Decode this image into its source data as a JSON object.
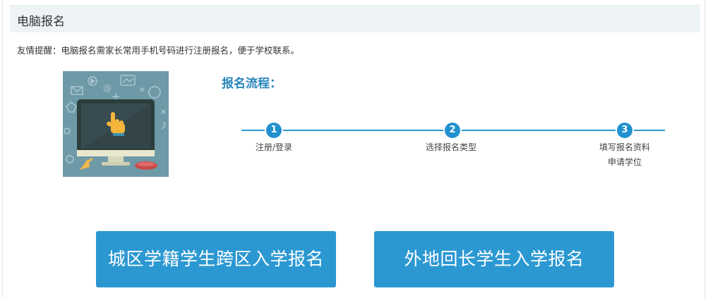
{
  "header": {
    "title": "电脑报名"
  },
  "reminder": "友情提醒：电脑报名需家长常用手机号码进行注册报名，便于学校联系。",
  "flow": {
    "title": "报名流程：",
    "steps": [
      {
        "number": "1",
        "label": "注册/登录"
      },
      {
        "number": "2",
        "label": "选择报名类型"
      },
      {
        "number": "3",
        "label_line1": "填写报名资料",
        "label_line2": "申请学位"
      }
    ]
  },
  "buttons": {
    "city": "城区学籍学生跨区入学报名",
    "outside": "外地回长学生入学报名"
  },
  "colors": {
    "accent": "#2b98d2",
    "flow_title": "#2a86bd",
    "header_bg": "#eef3f6"
  },
  "illustration": {
    "icon": "computer-with-hand-cursor-icon"
  }
}
